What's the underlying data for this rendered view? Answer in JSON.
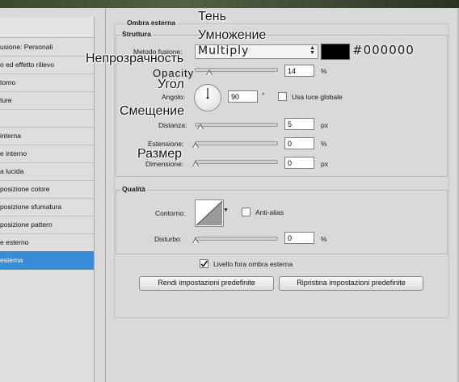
{
  "window": {
    "section_title": "Ombra esterna"
  },
  "left_list": {
    "items": [
      "usione: Personali",
      "o ed effetto rilievo",
      "torno",
      "ture",
      "",
      "interna",
      "e interno",
      "a lucida",
      "posizione colore",
      "posizione sfumatura",
      "posizione pattern",
      "e esterno",
      "esterna"
    ],
    "selected_index": 12
  },
  "struttura": {
    "title": "Struttura",
    "blend_label": "Metodo fusione:",
    "blend_value": "Multiply",
    "color_hex_overlay": "#000000",
    "color": "#000000",
    "opacity_label": "Opacity",
    "opacity_value": "14",
    "opacity_unit": "%",
    "opacity_level": 14,
    "angle_label": "Angolo:",
    "angle_value": "90",
    "angle_unit": "°",
    "global_light_label": "Usa luce globale",
    "global_light_checked": false,
    "distance_label": "Distanza:",
    "distance_value": "5",
    "distance_unit": "px",
    "spread_label": "Estensione:",
    "spread_value": "0",
    "spread_unit": "%",
    "size_label": "Dimensione:",
    "size_value": "0",
    "size_unit": "px"
  },
  "qualita": {
    "title": "Qualità",
    "contour_label": "Contorno:",
    "antialias_label": "Anti-alias",
    "antialias_checked": false,
    "noise_label": "Disturbo:",
    "noise_value": "0",
    "noise_unit": "%"
  },
  "knockout": {
    "label": "Livello fora ombra esterna",
    "checked": true
  },
  "buttons": {
    "make_default": "Rendi impostazioni predefinite",
    "reset_default": "Ripristina impostazioni predefinite"
  },
  "overlay_ru": {
    "shadow": "Тень",
    "multiply": "Умножение",
    "opacity": "Непрозрачность",
    "angle": "Угол",
    "offset": "Смещение",
    "size": "Размер"
  },
  "colors": {
    "accent_selected": "#3b8bdb",
    "panel": "#d9d9d9"
  }
}
